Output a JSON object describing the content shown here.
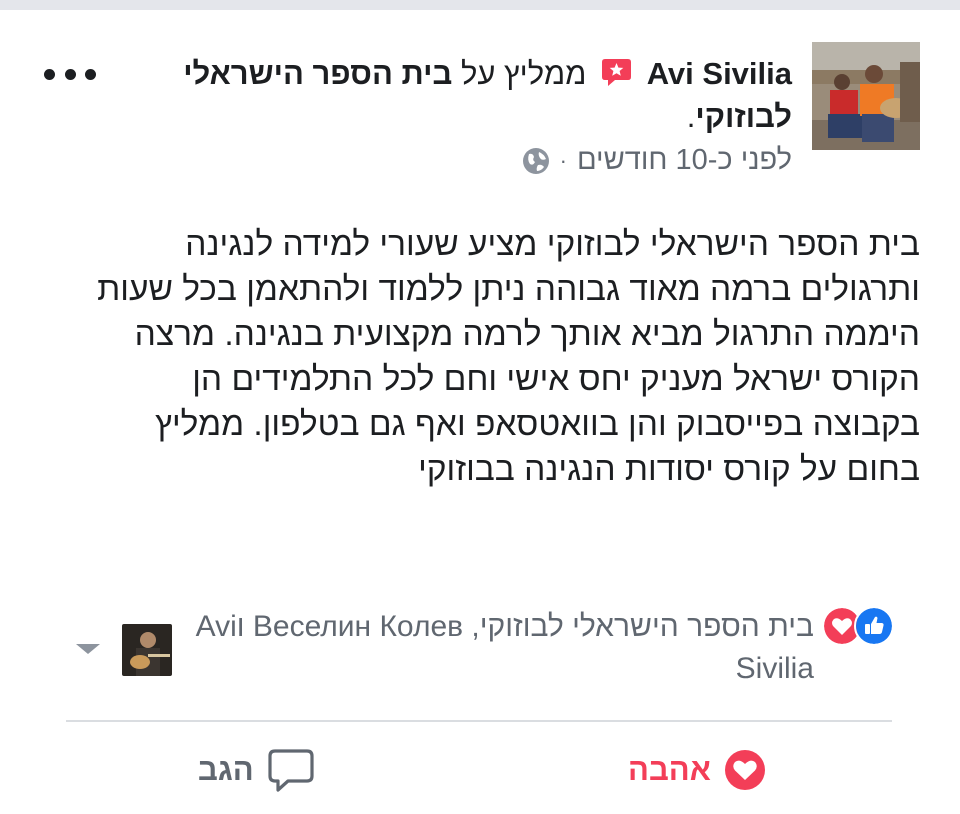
{
  "post": {
    "author": "Avi Sivilia",
    "recommends_text": "ממליץ על",
    "page_name": "בית הספר הישראלי לבוזוקי",
    "suffix": ".",
    "time": "לפני כ-10 חודשים",
    "separator": "·",
    "privacy_icon": "globe-icon",
    "more_icon": "more-dots-icon",
    "body": "בית הספר הישראלי לבוזוקי מציע שעורי למידה לנגינה ותרגולים ברמה מאוד גבוהה ניתן ללמוד ולהתאמן בכל שעות היממה התרגול מביא אותך לרמה מקצועית בנגינה. מרצה הקורס ישראל מעניק יחס אישי וחם לכל התלמידים הן בקבוצה בפייסבוק והן בוואטסאפ ואף גם בטלפון. ממליץ בחום על קורס יסודות הנגינה בבוזוקי"
  },
  "reactions": {
    "icons": [
      "like-icon",
      "love-icon"
    ],
    "names": "בית הספר הישראלי לבוזוקי, Веселин Колев וAvi Sivilia"
  },
  "actions": {
    "love_label": "אהבה",
    "comment_label": "הגב"
  },
  "colors": {
    "love": "#f33e58",
    "like": "#1877f2",
    "text": "#1c1e21",
    "muted": "#606770"
  }
}
